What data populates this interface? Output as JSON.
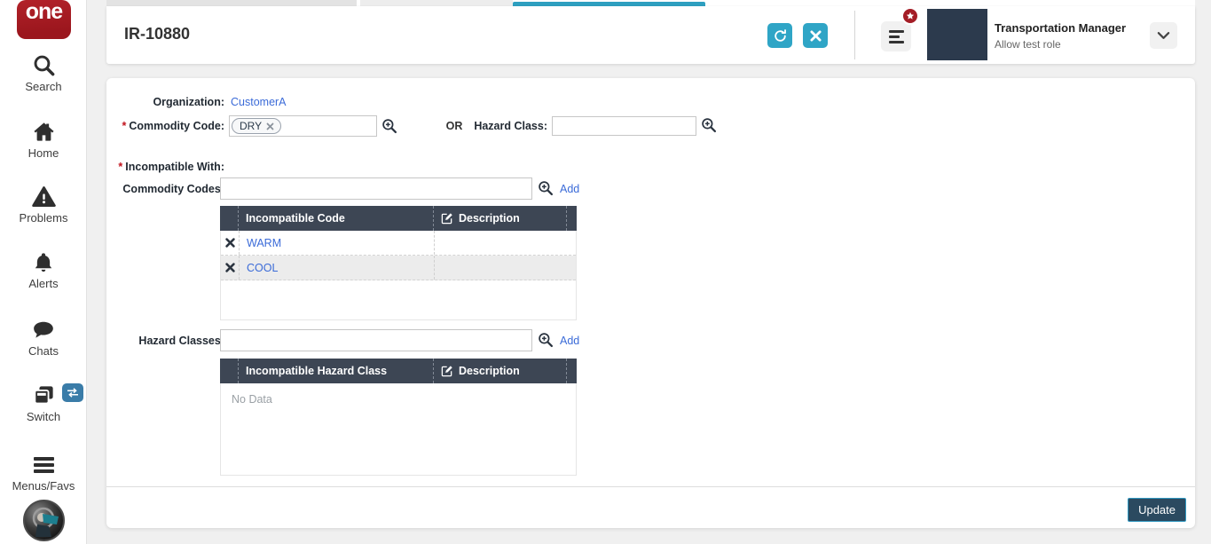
{
  "sidebar": {
    "logo_text": "one",
    "items": [
      {
        "id": "search",
        "label": "Search"
      },
      {
        "id": "home",
        "label": "Home"
      },
      {
        "id": "problems",
        "label": "Problems"
      },
      {
        "id": "alerts",
        "label": "Alerts"
      },
      {
        "id": "chats",
        "label": "Chats"
      },
      {
        "id": "switch",
        "label": "Switch"
      },
      {
        "id": "menus-favs",
        "label": "Menus/Favs"
      }
    ]
  },
  "header": {
    "title": "IR-10880",
    "user_role": "Transportation Manager",
    "user_subtitle": "Allow test role"
  },
  "form": {
    "required_marker": "*",
    "organization_label": "Organization:",
    "organization_value": "CustomerA",
    "commodity_code_label": "Commodity Code:",
    "commodity_code_chip": "DRY",
    "or_label": "OR",
    "hazard_class_label": "Hazard Class:",
    "incompatible_with_label": "Incompatible With:",
    "commodity_codes_label": "Commodity Codes:",
    "hazard_classes_label": "Hazard Classes:",
    "add_label": "Add",
    "update_label": "Update"
  },
  "codes_table": {
    "col_code": "Incompatible Code",
    "col_description": "Description",
    "rows": [
      {
        "code": "WARM",
        "description": ""
      },
      {
        "code": "COOL",
        "description": ""
      }
    ]
  },
  "hazard_table": {
    "col_class": "Incompatible Hazard Class",
    "col_description": "Description",
    "empty_text": "No Data"
  },
  "colors": {
    "accent_teal": "#2fa5c6",
    "active_tab_teal": "#2e9fc0",
    "link_blue": "#3b6bd8",
    "table_header_bg": "#3d4654",
    "brand_red": "#a81e24",
    "badge_red": "#a41d26",
    "avatar_navy": "#2c3a4d",
    "update_button_bg": "#2b4a60",
    "update_button_border": "#2f97c0",
    "row_alt_bg": "#ececec"
  }
}
